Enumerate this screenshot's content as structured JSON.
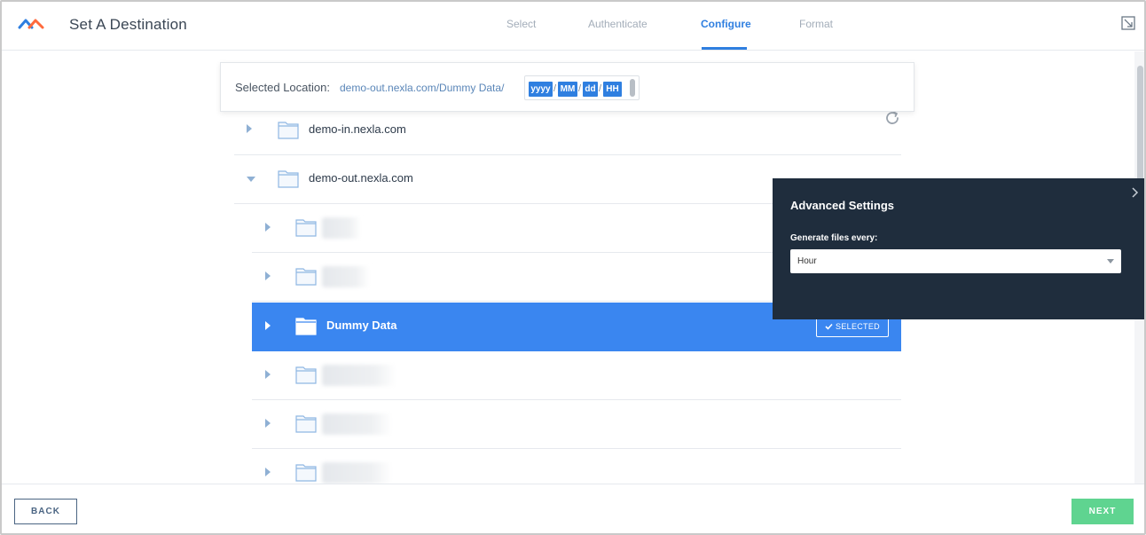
{
  "header": {
    "title": "Set A Destination",
    "steps": [
      {
        "label": "Select",
        "active": false
      },
      {
        "label": "Authenticate",
        "active": false
      },
      {
        "label": "Configure",
        "active": true
      },
      {
        "label": "Format",
        "active": false
      }
    ]
  },
  "location": {
    "label": "Selected Location:",
    "path": "demo-out.nexla.com/Dummy Data/",
    "pattern": [
      "yyyy",
      "MM",
      "dd",
      "HH"
    ],
    "separator": "/"
  },
  "tree": [
    {
      "name": "demo-in.nexla.com",
      "expanded": false,
      "level": 0
    },
    {
      "name": "demo-out.nexla.com",
      "expanded": true,
      "level": 0
    },
    {
      "name": "",
      "blurred": true,
      "level": 1
    },
    {
      "name": "",
      "blurred": true,
      "level": 1
    },
    {
      "name": "Dummy Data",
      "selected": true,
      "level": 1
    },
    {
      "name": "",
      "blurred": true,
      "level": 1
    },
    {
      "name": "",
      "blurred": true,
      "level": 1
    },
    {
      "name": "",
      "blurred": true,
      "level": 1
    }
  ],
  "selected_badge": "SELECTED",
  "advanced": {
    "title": "Advanced Settings",
    "field_label": "Generate files every:",
    "field_value": "Hour"
  },
  "footer": {
    "back_label": "BACK",
    "next_label": "NEXT"
  },
  "colors": {
    "accent": "#2f7fe0",
    "selected_row": "#3a86f0",
    "panel_bg": "#1f2d3d",
    "next_button": "#5fd490"
  }
}
